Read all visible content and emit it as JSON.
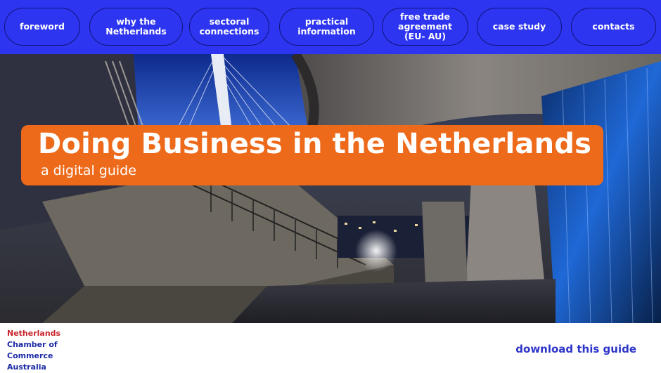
{
  "nav": {
    "items": [
      {
        "label": "foreword"
      },
      {
        "label": "why the\nNetherlands"
      },
      {
        "label": "sectoral\nconnections"
      },
      {
        "label": "practical\ninformation"
      },
      {
        "label": "free trade\nagreement\n(EU- AU)"
      },
      {
        "label": "case study"
      },
      {
        "label": "contacts"
      }
    ]
  },
  "hero": {
    "title": "Doing Business in the Netherlands",
    "subtitle": "a digital guide"
  },
  "footer": {
    "logo": {
      "line1": "Netherlands",
      "line2": "Chamber of",
      "line3": "Commerce",
      "line4": "Australia"
    },
    "download_label": "download this guide"
  },
  "colors": {
    "nav_bg": "#2d35f0",
    "banner": "#ee6a1b",
    "logo_red": "#c9252c",
    "logo_blue": "#1c2ba6",
    "link_blue": "#2d35c8"
  }
}
